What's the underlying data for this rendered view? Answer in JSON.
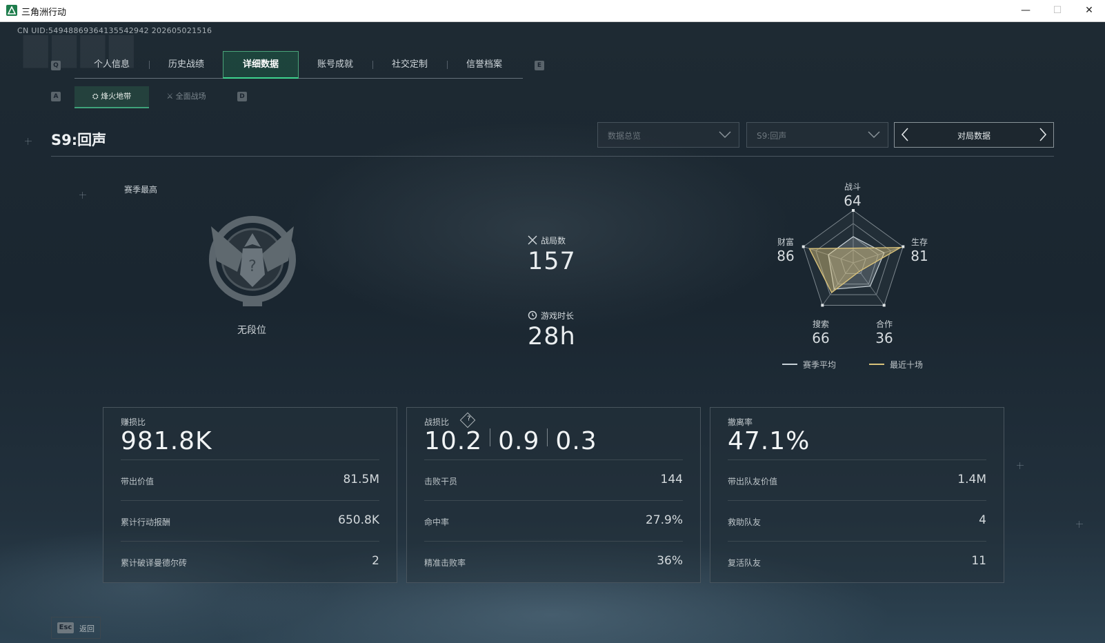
{
  "window": {
    "title": "三角洲行动",
    "minimize": "—",
    "maximize": "☐",
    "close": "✕"
  },
  "uid": "CN UID:5494886936413554294­2 202605021516",
  "key_hints": {
    "prev_tab": "Q",
    "next_tab": "E",
    "prev_sub": "A",
    "next_sub": "D"
  },
  "tabs": [
    {
      "label": "个人信息",
      "active": false
    },
    {
      "label": "历史战绩",
      "active": false
    },
    {
      "label": "详细数据",
      "active": true
    },
    {
      "label": "账号成就",
      "active": false
    },
    {
      "label": "社交定制",
      "active": false
    },
    {
      "label": "信誉档案",
      "active": false
    }
  ],
  "subtabs": [
    {
      "label": "烽火地带",
      "active": true
    },
    {
      "label": "全面战场",
      "active": false
    }
  ],
  "season_title": "S9:回声",
  "dropdowns": {
    "overview": "数据总览",
    "season": "S9:回声"
  },
  "pager": {
    "label": "对局数据"
  },
  "rank": {
    "label": "赛季最高",
    "name": "无段位"
  },
  "stats": {
    "matches": {
      "label": "战局数",
      "value": "157"
    },
    "playtime": {
      "label": "游戏时长",
      "value": "28h"
    }
  },
  "radar": {
    "axes": [
      {
        "name": "战斗",
        "value": "64"
      },
      {
        "name": "生存",
        "value": "81"
      },
      {
        "name": "合作",
        "value": "36"
      },
      {
        "name": "搜索",
        "value": "66"
      },
      {
        "name": "财富",
        "value": "86"
      }
    ],
    "season_avg": [
      0.5,
      0.62,
      0.55,
      0.62,
      0.5
    ],
    "recent_ten": [
      0.28,
      0.95,
      0.2,
      0.7,
      0.88
    ],
    "legend": {
      "season_avg": "赛季平均",
      "recent_ten": "最近十场"
    },
    "colors": {
      "season_avg": "#c8d2d8",
      "recent_ten": "#d9c27a"
    }
  },
  "cards": {
    "profit": {
      "label": "赚损比",
      "value": "981.8K",
      "rows": [
        {
          "label": "带出价值",
          "value": "81.5M"
        },
        {
          "label": "累计行动报酬",
          "value": "650.8K"
        },
        {
          "label": "累计破译曼德尔砖",
          "value": "2"
        }
      ]
    },
    "kd": {
      "label": "战损比",
      "help": "?",
      "values": [
        "10.2",
        "0.9",
        "0.3"
      ],
      "rows": [
        {
          "label": "击败干员",
          "value": "144"
        },
        {
          "label": "命中率",
          "value": "27.9%"
        },
        {
          "label": "精准击败率",
          "value": "36%"
        }
      ]
    },
    "extract": {
      "label": "撤离率",
      "value": "47.1%",
      "rows": [
        {
          "label": "带出队友价值",
          "value": "1.4M"
        },
        {
          "label": "救助队友",
          "value": "4"
        },
        {
          "label": "复活队友",
          "value": "11"
        }
      ]
    }
  },
  "footer": {
    "esc_key": "Esc",
    "back": "返回"
  }
}
